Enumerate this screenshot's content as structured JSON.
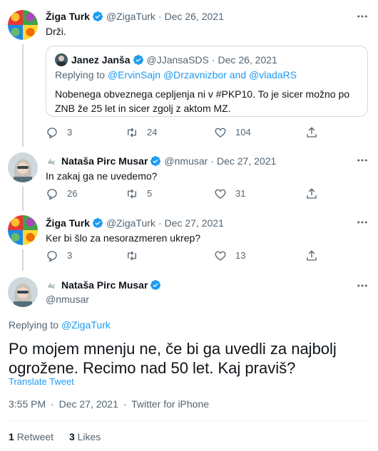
{
  "tweets": [
    {
      "name": "Žiga Turk",
      "handle": "@ZigaTurk",
      "date": "Dec 26, 2021",
      "text": "Drži.",
      "quote": {
        "name": "Janez Janša",
        "handle": "@JJansaSDS",
        "date": "Dec 26, 2021",
        "replying_prefix": "Replying to",
        "replying_to": "@ErvinSajn @Drzavnizbor and @vladaRS",
        "text": "Nobenega obveznega cepljenja ni v #PKP10. To je sicer možno po ZNB že 25 let in sicer zgolj z aktom MZ."
      },
      "replies": "3",
      "retweets": "24",
      "likes": "104"
    },
    {
      "prefix_icon": "peace-dove-emoji",
      "name": "Nataša Pirc Musar",
      "handle": "@nmusar",
      "date": "Dec 27, 2021",
      "text": "In zakaj ga ne uvedemo?",
      "replies": "26",
      "retweets": "5",
      "likes": "31"
    },
    {
      "name": "Žiga Turk",
      "handle": "@ZigaTurk",
      "date": "Dec 27, 2021",
      "text": "Ker bi šlo za nesorazmeren ukrep?",
      "replies": "3",
      "retweets": "",
      "likes": "13"
    }
  ],
  "main": {
    "prefix_icon": "peace-dove-emoji",
    "name": "Nataša Pirc Musar",
    "handle": "@nmusar",
    "replying_prefix": "Replying to",
    "replying_to": "@ZigaTurk",
    "text": "Po mojem mnenju ne, če bi ga uvedli za najbolj ogrožene. Recimo nad 50 let. Kaj praviš?",
    "translate": "Translate Tweet",
    "time": "3:55 PM",
    "date": "Dec 27, 2021",
    "source": "Twitter for iPhone",
    "retweets_count": "1",
    "retweets_label": "Retweet",
    "likes_count": "3",
    "likes_label": "Likes"
  },
  "separator": "·",
  "colors": {
    "accent": "#1d9bf0",
    "muted": "#536471",
    "border": "#cfd9de"
  }
}
